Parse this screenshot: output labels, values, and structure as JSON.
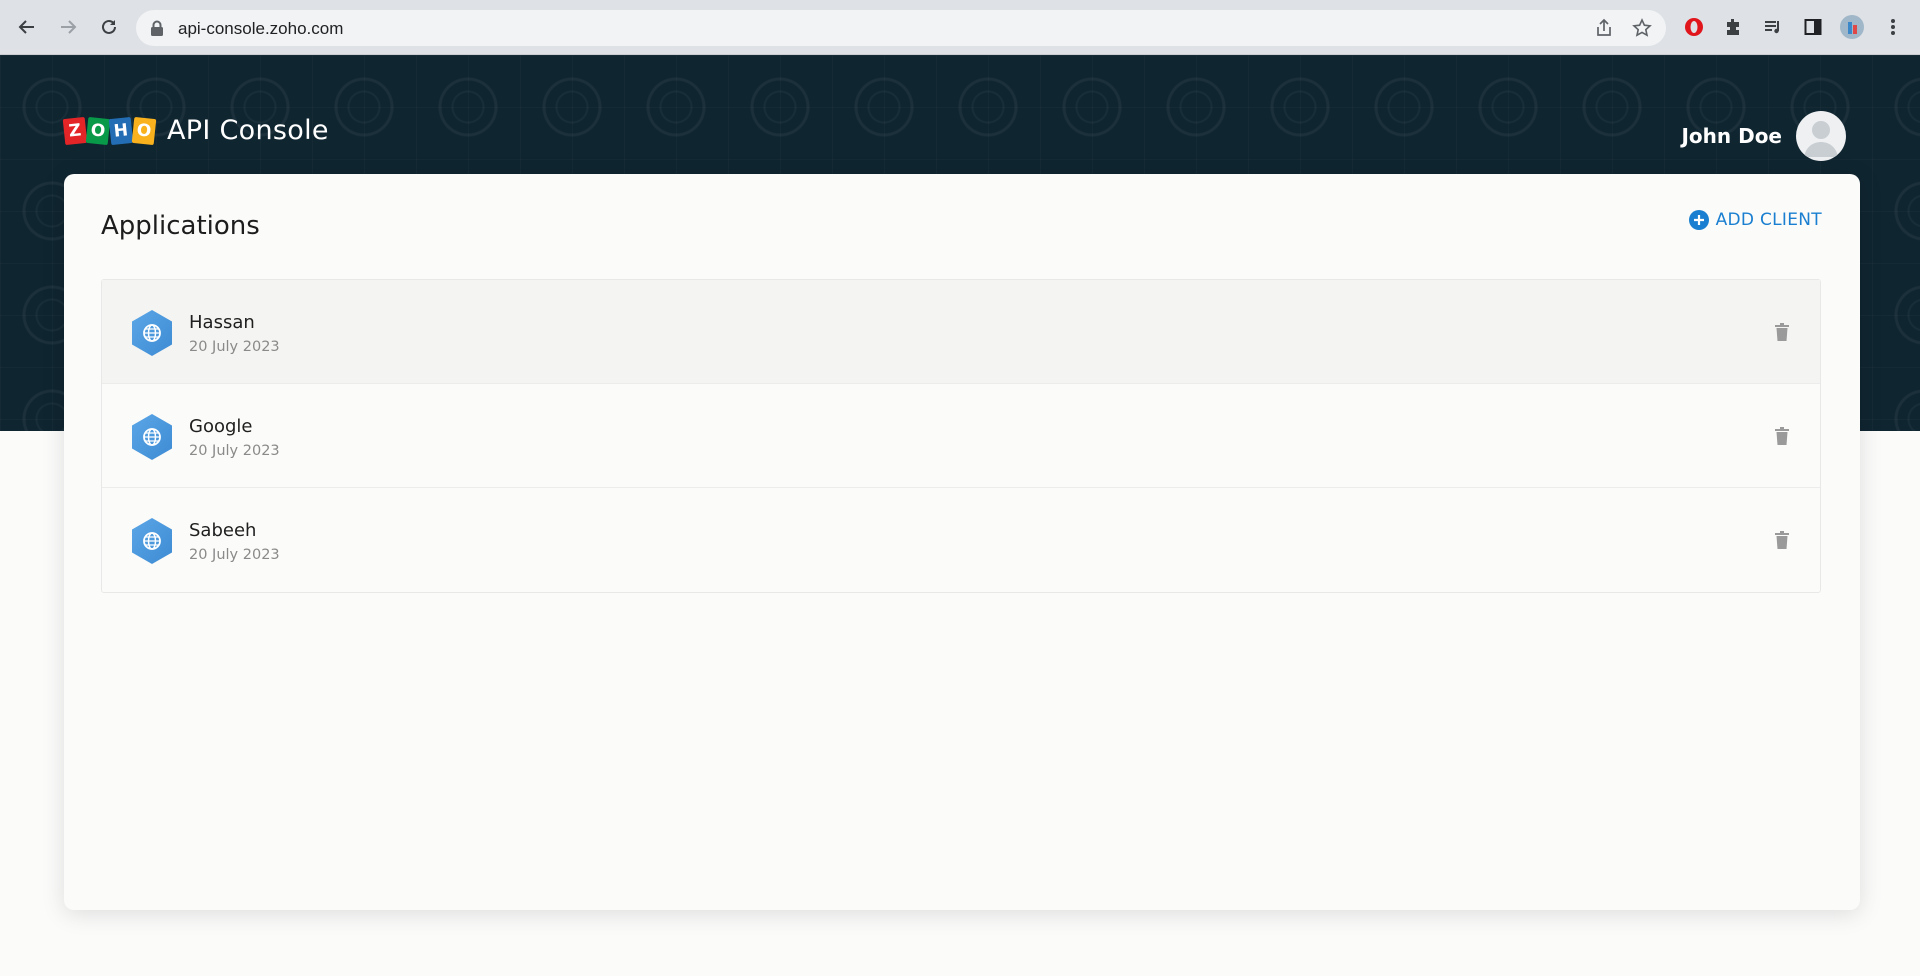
{
  "browser": {
    "url": "api-console.zoho.com"
  },
  "header": {
    "logo_letters": [
      "Z",
      "O",
      "H",
      "O"
    ],
    "logo_colors": [
      "#e42527",
      "#089949",
      "#226db4",
      "#f9b21d"
    ],
    "title": "API Console",
    "user_name": "John Doe"
  },
  "main": {
    "title": "Applications",
    "add_client_label": "ADD CLIENT",
    "accent_color": "#1a7fd0",
    "applications": [
      {
        "name": "Hassan",
        "date": "20 July 2023"
      },
      {
        "name": "Google",
        "date": "20 July 2023"
      },
      {
        "name": "Sabeeh",
        "date": "20 July 2023"
      }
    ]
  }
}
